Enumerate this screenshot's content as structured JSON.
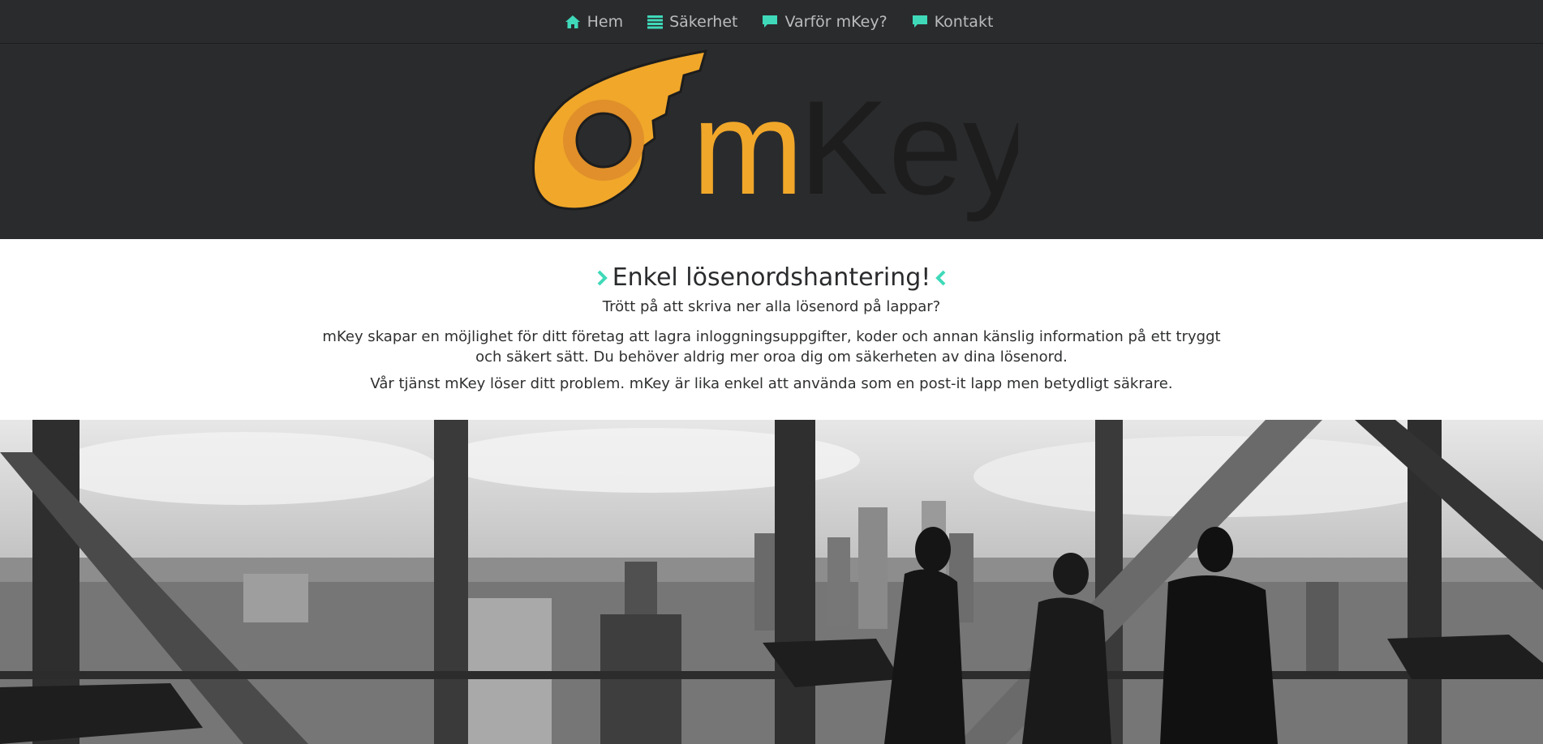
{
  "nav": {
    "items": [
      {
        "label": "Hem",
        "icon": "home-icon"
      },
      {
        "label": "Säkerhet",
        "icon": "list-icon"
      },
      {
        "label": "Varför mKey?",
        "icon": "chat-icon"
      },
      {
        "label": "Kontakt",
        "icon": "chat-icon"
      }
    ],
    "icon_color": "#3fd9b9",
    "text_color": "#b9bbbc"
  },
  "logo": {
    "text_m": "m",
    "text_key": "Key",
    "accent": "#f0a72a",
    "dark": "#1d1d1d"
  },
  "intro": {
    "heading": "Enkel lösenordshantering!",
    "subheading": "Trött på att skriva ner alla lösenord på lappar?",
    "body": "mKey skapar en möjlighet för ditt företag att lagra inloggningsuppgifter, koder och annan känslig information på ett tryggt och säkert sätt. Du behöver aldrig mer oroa dig om säkerheten av dina lösenord.",
    "body2": "Vår tjänst mKey löser ditt problem. mKey är lika enkel att använda som en post-it lapp men betydligt säkrare.",
    "chevron_color": "#3fd9b9"
  },
  "colors": {
    "header_bg": "#2a2b2d",
    "page_bg": "#ffffff"
  }
}
